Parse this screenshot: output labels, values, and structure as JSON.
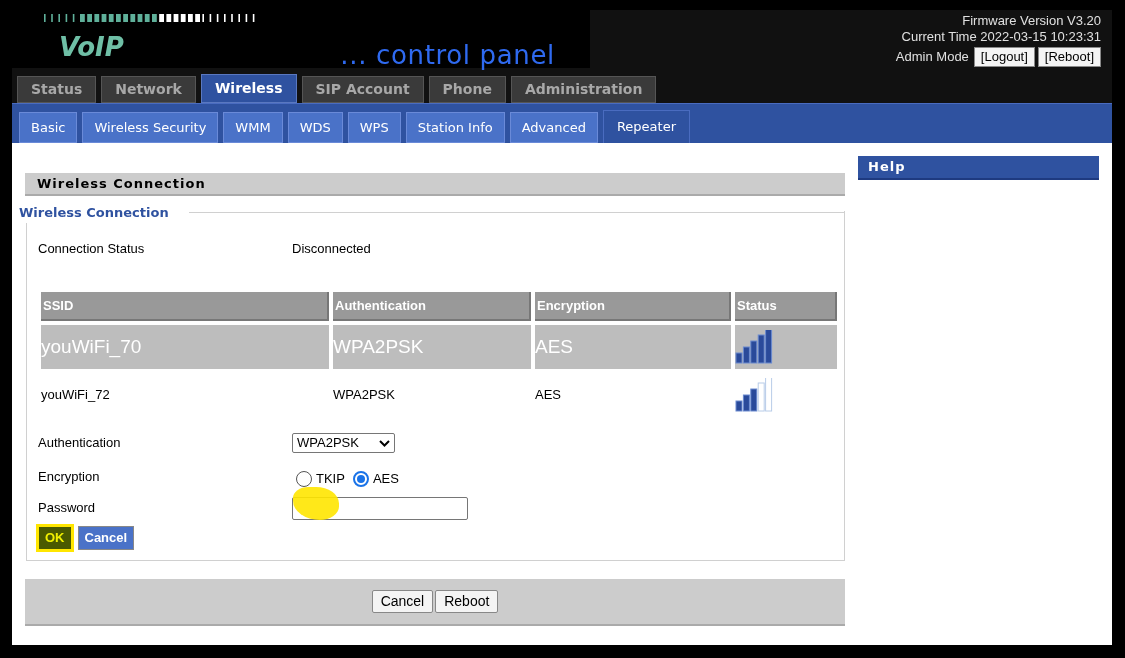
{
  "logo": {
    "brand": "VoIP",
    "tagline": "... control panel"
  },
  "header_info": {
    "firmware": "Firmware Version V3.20",
    "time": "Current Time 2022-03-15 10:23:31",
    "mode": "Admin Mode",
    "buttons": [
      "[Logout]",
      "[Reboot]"
    ]
  },
  "main_tabs": [
    {
      "label": "Status",
      "selected": false
    },
    {
      "label": "Network",
      "selected": false
    },
    {
      "label": "Wireless",
      "selected": true
    },
    {
      "label": "SIP Account",
      "selected": false
    },
    {
      "label": "Phone",
      "selected": false
    },
    {
      "label": "Administration",
      "selected": false
    }
  ],
  "sub_tabs": [
    {
      "label": "Basic",
      "selected": false
    },
    {
      "label": "Wireless Security",
      "selected": false
    },
    {
      "label": "WMM",
      "selected": false
    },
    {
      "label": "WDS",
      "selected": false
    },
    {
      "label": "WPS",
      "selected": false
    },
    {
      "label": "Station Info",
      "selected": false
    },
    {
      "label": "Advanced",
      "selected": false
    },
    {
      "label": "Repeater",
      "selected": true
    }
  ],
  "section_title": "Wireless Connection",
  "fieldset": {
    "legend": "Wireless Connection",
    "status_label": "Connection Status",
    "status_value": "Disconnected"
  },
  "table": {
    "columns": [
      "SSID",
      "Authentication",
      "Encryption",
      "Status"
    ],
    "rows": [
      {
        "ssid": "youWiFi_70",
        "auth": "WPA2PSK",
        "enc": "AES",
        "kind": "strong",
        "selected": true
      },
      {
        "ssid": "youWiFi_72",
        "auth": "WPA2PSK",
        "enc": "AES",
        "kind": "fair",
        "selected": false
      }
    ]
  },
  "form": {
    "auth_label": "Authentication",
    "auth_value": "WPA2PSK",
    "enc_label": "Encryption",
    "enc_options": [
      {
        "label": "TKIP",
        "selected": false
      },
      {
        "label": "AES",
        "selected": true
      }
    ],
    "password_label": "Password",
    "password_highlighted": true,
    "buttons": [
      {
        "label": "OK",
        "highlighted": true
      },
      {
        "label": "Cancel",
        "highlighted": false
      }
    ]
  },
  "footer_buttons": [
    "Cancel",
    "Reboot"
  ],
  "help": {
    "title": "Help"
  }
}
